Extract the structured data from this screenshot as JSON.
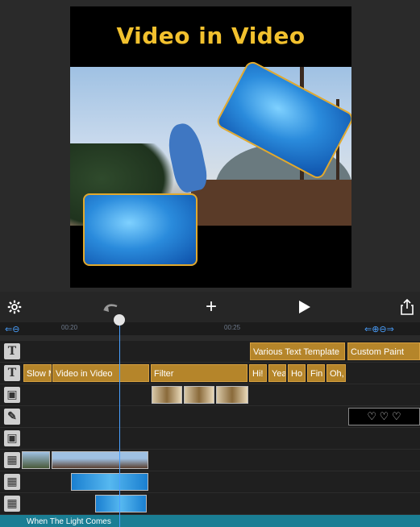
{
  "preview": {
    "title": "Video in Video"
  },
  "toolbar": {
    "settings_icon": "gear-icon",
    "undo_icon": "undo-icon",
    "add_label": "+",
    "play_icon": "play-icon",
    "share_icon": "share-icon"
  },
  "ruler": {
    "time_1": "00:20",
    "time_2": "00:25"
  },
  "tracks": {
    "text_top": [
      "Various Text Template",
      "Custom Paint"
    ],
    "text_main": [
      "Slow M",
      "Video in Video",
      "Filter",
      "Hi! I",
      "Yea",
      "Ho",
      "Fin",
      "Oh,"
    ],
    "audio": "When The Light Comes"
  },
  "colors": {
    "accent": "#f2c12e",
    "clip": "#b5852a",
    "playhead": "#4aa0ff",
    "audio": "#1a7e94"
  }
}
